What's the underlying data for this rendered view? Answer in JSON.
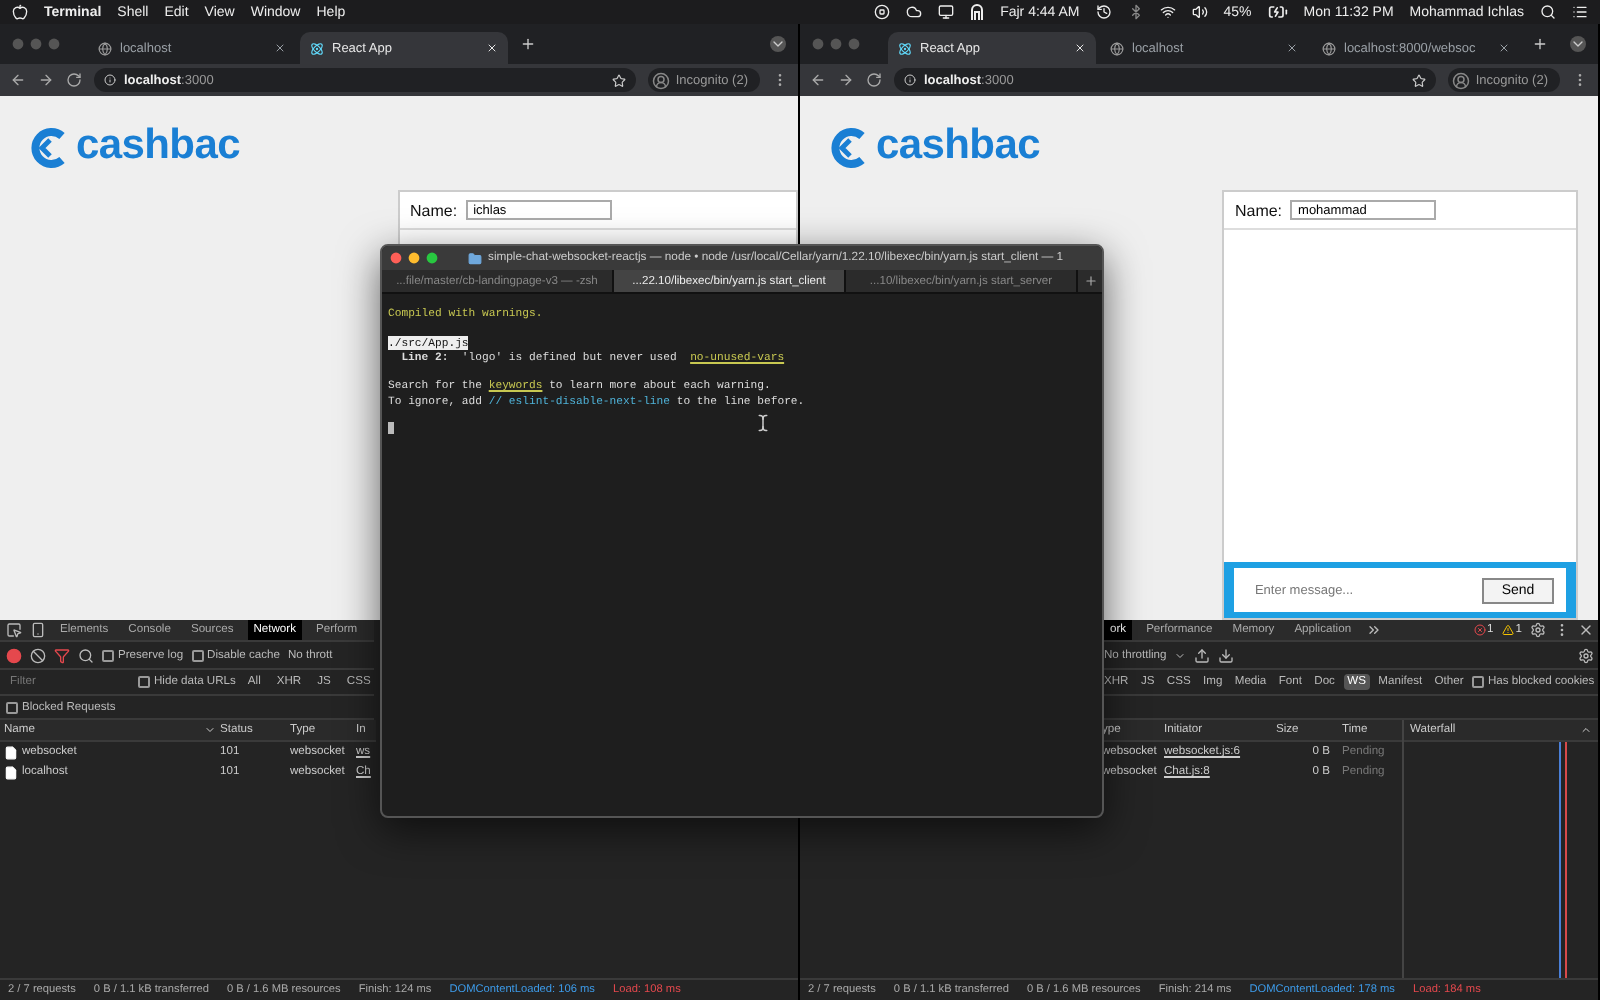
{
  "menubar": {
    "app": "Terminal",
    "menus": [
      "Shell",
      "Edit",
      "View",
      "Window",
      "Help"
    ],
    "prayer_time": "Fajr 4:44 AM",
    "battery": "45%",
    "clock": "Mon 11:32 PM",
    "user": "Mohammad Ichlas"
  },
  "browsers": [
    {
      "tabs": [
        {
          "title": "localhost",
          "kind": "globe",
          "selected": false
        },
        {
          "title": "React App",
          "kind": "react",
          "selected": true
        }
      ],
      "address": {
        "host": "localhost",
        "port": ":3000"
      },
      "profile": "Incognito (2)",
      "page": {
        "logo": "cashbac",
        "name_label": "Name:",
        "name_value": "ichlas"
      },
      "devtools": {
        "panels": [
          {
            "label": "Elements",
            "selected": false
          },
          {
            "label": "Console",
            "selected": false
          },
          {
            "label": "Sources",
            "selected": false
          },
          {
            "label": "Network",
            "selected": true
          },
          {
            "label": "Perform",
            "selected": false
          }
        ],
        "toggles": [
          {
            "label": "Preserve log",
            "checked": false
          },
          {
            "label": "Disable cache",
            "checked": false
          }
        ],
        "throttling": "No thrott",
        "filter_placeholder": "Filter",
        "filter_options": [
          {
            "label": "Hide data URLs",
            "checked": false
          }
        ],
        "types": [
          {
            "label": "All",
            "selected": false
          },
          {
            "label": "XHR",
            "selected": false
          },
          {
            "label": "JS",
            "selected": false
          },
          {
            "label": "CSS",
            "selected": false
          }
        ],
        "blocked_requests": {
          "label": "Blocked Requests",
          "checked": false
        },
        "columns": [
          "Name",
          "Status",
          "Type",
          "In"
        ],
        "rows": [
          [
            "websocket",
            "101",
            "websocket",
            "ws"
          ],
          [
            "localhost",
            "101",
            "websocket",
            "Ch"
          ]
        ]
      },
      "status_bar": [
        {
          "text": "2 / 7 requests",
          "kind": "plain"
        },
        {
          "text": "0 B / 1.1 kB transferred",
          "kind": "plain"
        },
        {
          "text": "0 B / 1.6 MB resources",
          "kind": "plain"
        },
        {
          "text": "Finish: 124 ms",
          "kind": "plain"
        },
        {
          "text": "DOMContentLoaded: 106 ms",
          "kind": "dcl"
        },
        {
          "text": "Load: 108 ms",
          "kind": "load"
        }
      ]
    },
    {
      "tabs": [
        {
          "title": "React App",
          "kind": "react",
          "selected": true
        },
        {
          "title": "localhost",
          "kind": "globe",
          "selected": false
        },
        {
          "title": "localhost:8000/websoc",
          "kind": "globe",
          "selected": false
        }
      ],
      "address": {
        "host": "localhost",
        "port": ":3000"
      },
      "profile": "Incognito (2)",
      "page": {
        "logo": "cashbac",
        "name_label": "Name:",
        "name_value": "mohammad",
        "message_placeholder": "Enter message...",
        "send": "Send"
      },
      "devtools": {
        "panels": [
          {
            "label": "ork",
            "selected": true
          },
          {
            "label": "Performance",
            "selected": false
          },
          {
            "label": "Memory",
            "selected": false
          },
          {
            "label": "Application",
            "selected": false
          }
        ],
        "issues": {
          "errors": "1",
          "warnings": "1"
        },
        "throttling": "No throttling",
        "types": [
          {
            "label": "XHR",
            "selected": false
          },
          {
            "label": "JS",
            "selected": false
          },
          {
            "label": "CSS",
            "selected": false
          },
          {
            "label": "Img",
            "selected": false
          },
          {
            "label": "Media",
            "selected": false
          },
          {
            "label": "Font",
            "selected": false
          },
          {
            "label": "Doc",
            "selected": false
          },
          {
            "label": "WS",
            "selected": true
          },
          {
            "label": "Manifest",
            "selected": false
          },
          {
            "label": "Other",
            "selected": false
          }
        ],
        "filter_options": [
          {
            "label": "Has blocked cookies",
            "checked": false
          }
        ],
        "columns": [
          "ype",
          "Initiator",
          "Size",
          "Time"
        ],
        "waterfall": "Waterfall",
        "rows": [
          [
            "websocket",
            "websocket.js:6",
            "0 B",
            "Pending"
          ],
          [
            "websocket",
            "Chat.js:8",
            "0 B",
            "Pending"
          ]
        ]
      },
      "status_bar": [
        {
          "text": "2 / 7 requests",
          "kind": "plain"
        },
        {
          "text": "0 B / 1.1 kB transferred",
          "kind": "plain"
        },
        {
          "text": "0 B / 1.6 MB resources",
          "kind": "plain"
        },
        {
          "text": "Finish: 214 ms",
          "kind": "plain"
        },
        {
          "text": "DOMContentLoaded: 178 ms",
          "kind": "dcl"
        },
        {
          "text": "Load: 184 ms",
          "kind": "load"
        }
      ]
    }
  ],
  "terminal": {
    "title": "simple-chat-websocket-reactjs — node • node /usr/local/Cellar/yarn/1.22.10/libexec/bin/yarn.js start_client — 1",
    "tabs": [
      {
        "title": "...file/master/cb-landingpage-v3 — -zsh",
        "selected": false
      },
      {
        "title": "...22.10/libexec/bin/yarn.js start_client",
        "selected": true
      },
      {
        "title": "...10/libexec/bin/yarn.js start_server",
        "selected": false
      }
    ],
    "paragraphs": [
      [
        [
          {
            "text": "Compiled with warnings.",
            "kind": "warning"
          }
        ]
      ],
      [
        [
          {
            "text": "./src/App.js",
            "kind": "path"
          }
        ],
        [
          {
            "text": "Line 2:",
            "kind": "bold"
          },
          {
            "text": "  'logo' is defined but never used  ",
            "kind": "plain"
          },
          {
            "text": "no-unused-vars",
            "kind": "link"
          }
        ]
      ],
      [
        [
          {
            "text": "Search for the ",
            "kind": "plain"
          },
          {
            "text": "keywords",
            "kind": "link"
          },
          {
            "text": " to learn more about each warning.",
            "kind": "plain"
          }
        ],
        [
          {
            "text": "To ignore, add ",
            "kind": "plain"
          },
          {
            "text": "// eslint-disable-next-line",
            "kind": "code"
          },
          {
            "text": " to the line before.",
            "kind": "plain"
          }
        ]
      ]
    ]
  }
}
